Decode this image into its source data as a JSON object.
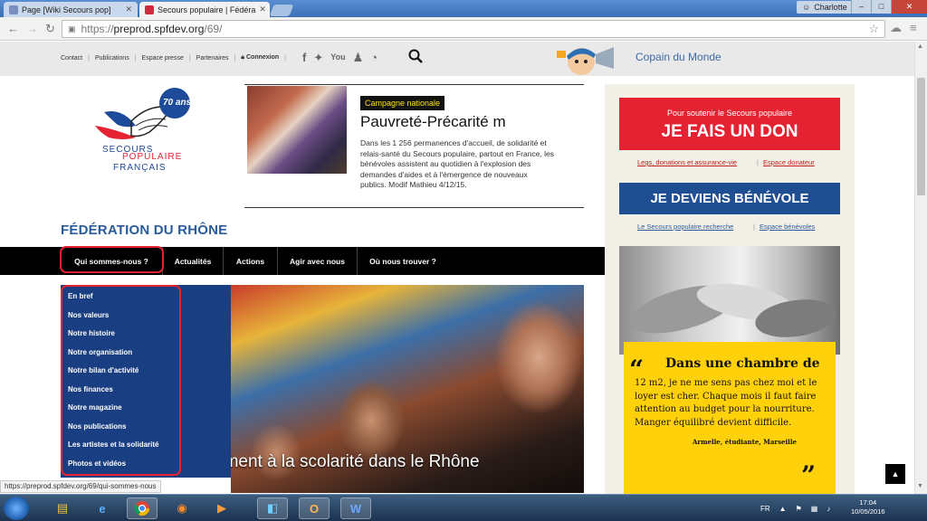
{
  "browser": {
    "tabs": [
      {
        "title": "Page [Wiki Secours pop]",
        "active": false
      },
      {
        "title": "Secours populaire | Fédéra",
        "active": true
      }
    ],
    "user": "Charlotte",
    "url_scheme": "https://",
    "url_host": "preprod.spfdev.org",
    "url_path": "/69/"
  },
  "utility": {
    "links": [
      "Contact",
      "Publications",
      "Espace presse",
      "Partenaires"
    ],
    "login": "Connexion",
    "copain": "Copain du Monde"
  },
  "logo": {
    "badge": "70 ans",
    "line1": "SECOURS",
    "line2": "POPULAIRE",
    "line3": "FRANÇAIS"
  },
  "feature": {
    "badge": "Campagne nationale",
    "title": "Pauvreté-Précarité m",
    "desc": "Dans les 1 256 permanences d'accueil, de solidarité et relais-santé du Secours populaire, partout en France, les bénévoles assistent au quotidien à l'explosion des demandes d'aides et à l'émergence de nouveaux publics. Modif Mathieu 4/12/15."
  },
  "federation_title": "FÉDÉRATION DU RHÔNE",
  "nav": [
    "Qui sommes-nous ?",
    "Actualités",
    "Actions",
    "Agir avec nous",
    "Où nous trouver ?"
  ],
  "dropdown": [
    "En bref",
    "Nos valeurs",
    "Notre histoire",
    "Notre organisation",
    "Notre bilan d'activité",
    "Nos finances",
    "Notre magazine",
    "Nos publications",
    "Les artistes et la solidarité",
    "Photos et vidéos"
  ],
  "hero_caption": "ement à la scolarité dans le Rhône",
  "sidebar": {
    "don_small": "Pour soutenir le Secours populaire",
    "don_big": "JE FAIS UN DON",
    "don_links": [
      "Legs, donations et assurance-vie",
      "Espace donateur"
    ],
    "benevole": "JE DEVIENS BÉNÉVOLE",
    "benevole_links": [
      "Le Secours populaire recherche",
      "Espace bénévoles"
    ],
    "quote_title": "Dans une chambre de",
    "quote_body": "12 m2, je ne me sens pas chez moi et le loyer est cher. Chaque mois il faut faire attention au budget pour la nourriture. Manger équilibré devient difficile.",
    "quote_author": "Armelle, étudiante, Marseille"
  },
  "status_url": "https://preprod.spfdev.org/69/qui-sommes-nous",
  "taskbar": {
    "lang": "FR",
    "time": "17:04",
    "date": "10/05/2016"
  }
}
